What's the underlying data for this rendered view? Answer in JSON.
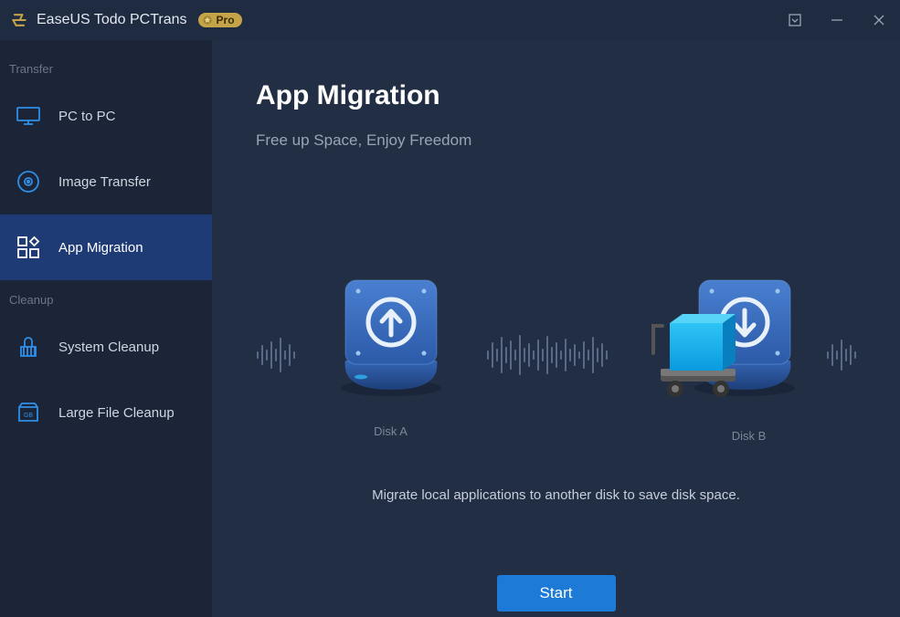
{
  "app": {
    "title": "EaseUS Todo PCTrans",
    "badge": "Pro"
  },
  "sidebar": {
    "sections": {
      "transfer": "Transfer",
      "cleanup": "Cleanup"
    },
    "items": {
      "pc_to_pc": "PC to PC",
      "image_transfer": "Image Transfer",
      "app_migration": "App Migration",
      "system_cleanup": "System Cleanup",
      "large_file_cleanup": "Large File Cleanup"
    }
  },
  "page": {
    "title": "App Migration",
    "subtitle": "Free up Space, Enjoy Freedom",
    "disk_a": "Disk A",
    "disk_b": "Disk B",
    "description": "Migrate local applications to another disk to save disk space.",
    "start_button": "Start"
  }
}
